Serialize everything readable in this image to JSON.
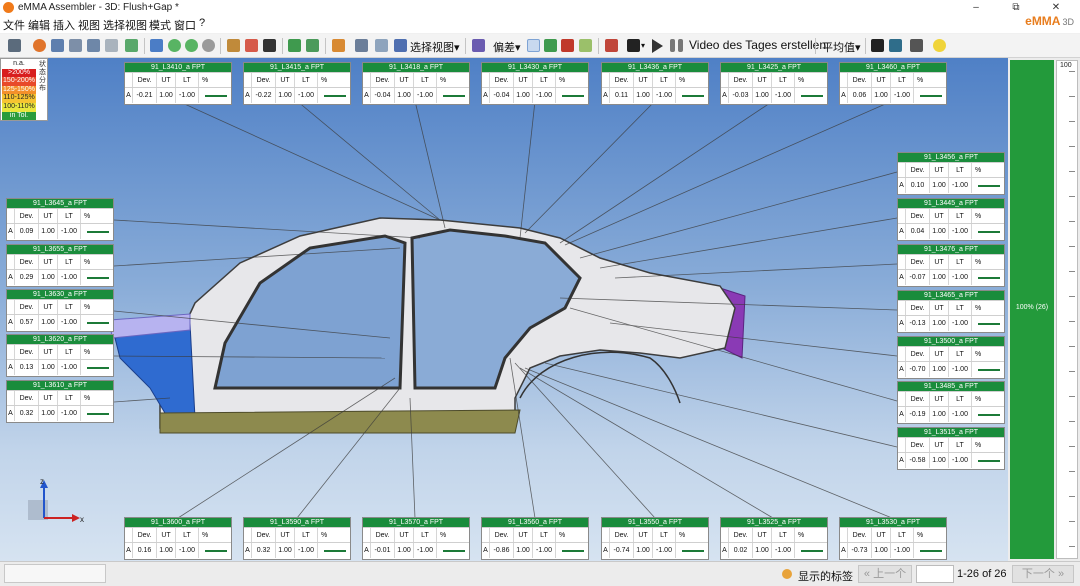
{
  "window": {
    "title": "eMMA Assembler - 3D: Flush+Gap *",
    "minimize": "–",
    "restore": "⧉",
    "close": "✕"
  },
  "brand": {
    "name": "eMMA",
    "suffix": "3D"
  },
  "menu": [
    "文件",
    "编辑",
    "插入",
    "视图",
    "选择视图",
    "模式",
    "窗口",
    "?"
  ],
  "toolbar": {
    "icons": [
      "new-icon",
      "open-icon",
      "save-icon",
      "save-as-icon",
      "print-icon",
      "copy-icon",
      "paste-icon",
      "refresh-icon",
      "back-icon",
      "forward-icon",
      "stop-icon",
      "import-icon",
      "export-icon",
      "pin-icon",
      "fit-icon",
      "link-icon",
      "home-icon",
      "camera-icon",
      "report-icon",
      "views-icon"
    ],
    "select_view": "选择视图",
    "deviation": "偏差",
    "video": "Video des Tages erstellen",
    "average": "平均值",
    "dropdown_arrow": "▾"
  },
  "legend": {
    "rows": [
      {
        "label": "n.a.",
        "color": "#ffffff"
      },
      {
        "label": ">200%",
        "color": "#d81e1e"
      },
      {
        "label": "150-200%",
        "color": "#e84a2a"
      },
      {
        "label": "125-150%",
        "color": "#f3902a"
      },
      {
        "label": "110-125%",
        "color": "#f6c431"
      },
      {
        "label": "100-110%",
        "color": "#e9e63c"
      },
      {
        "label": "in Tol.",
        "color": "#2a9c3c"
      }
    ],
    "vertical": "状态分布"
  },
  "card_headers": {
    "a": "A",
    "dev": "Dev.",
    "ut": "UT",
    "lt": "LT",
    "pct": "%"
  },
  "cards": [
    {
      "id": "91_L3410_a FPT",
      "dev": "-0.21",
      "ut": "1.00",
      "lt": "-1.00"
    },
    {
      "id": "91_L3415_a FPT",
      "dev": "-0.22",
      "ut": "1.00",
      "lt": "-1.00"
    },
    {
      "id": "91_L3418_a FPT",
      "dev": "-0.04",
      "ut": "1.00",
      "lt": "-1.00"
    },
    {
      "id": "91_L3430_a FPT",
      "dev": "-0.04",
      "ut": "1.00",
      "lt": "-1.00"
    },
    {
      "id": "91_L3436_a FPT",
      "dev": "0.11",
      "ut": "1.00",
      "lt": "-1.00"
    },
    {
      "id": "91_L3425_a FPT",
      "dev": "-0.03",
      "ut": "1.00",
      "lt": "-1.00"
    },
    {
      "id": "91_L3460_a FPT",
      "dev": "0.06",
      "ut": "1.00",
      "lt": "-1.00"
    },
    {
      "id": "91_L3456_a FPT",
      "dev": "0.10",
      "ut": "1.00",
      "lt": "-1.00"
    },
    {
      "id": "91_L3445_a FPT",
      "dev": "0.04",
      "ut": "1.00",
      "lt": "-1.00"
    },
    {
      "id": "91_L3476_a FPT",
      "dev": "-0.07",
      "ut": "1.00",
      "lt": "-1.00"
    },
    {
      "id": "91_L3465_a FPT",
      "dev": "-0.13",
      "ut": "1.00",
      "lt": "-1.00"
    },
    {
      "id": "91_L3500_a FPT",
      "dev": "-0.70",
      "ut": "1.00",
      "lt": "-1.00"
    },
    {
      "id": "91_L3485_a FPT",
      "dev": "-0.19",
      "ut": "1.00",
      "lt": "-1.00"
    },
    {
      "id": "91_L3515_a FPT",
      "dev": "-0.58",
      "ut": "1.00",
      "lt": "-1.00"
    },
    {
      "id": "91_L3645_a FPT",
      "dev": "0.09",
      "ut": "1.00",
      "lt": "-1.00"
    },
    {
      "id": "91_L3655_a FPT",
      "dev": "0.29",
      "ut": "1.00",
      "lt": "-1.00"
    },
    {
      "id": "91_L3630_a FPT",
      "dev": "0.57",
      "ut": "1.00",
      "lt": "-1.00"
    },
    {
      "id": "91_L3620_a FPT",
      "dev": "0.13",
      "ut": "1.00",
      "lt": "-1.00"
    },
    {
      "id": "91_L3610_a FPT",
      "dev": "0.32",
      "ut": "1.00",
      "lt": "-1.00"
    },
    {
      "id": "91_L3600_a FPT",
      "dev": "0.16",
      "ut": "1.00",
      "lt": "-1.00"
    },
    {
      "id": "91_L3590_a FPT",
      "dev": "0.32",
      "ut": "1.00",
      "lt": "-1.00"
    },
    {
      "id": "91_L3570_a FPT",
      "dev": "-0.01",
      "ut": "1.00",
      "lt": "-1.00"
    },
    {
      "id": "91_L3560_a FPT",
      "dev": "-0.86",
      "ut": "1.00",
      "lt": "-1.00"
    },
    {
      "id": "91_L3550_a FPT",
      "dev": "-0.74",
      "ut": "1.00",
      "lt": "-1.00"
    },
    {
      "id": "91_L3525_a FPT",
      "dev": "0.02",
      "ut": "1.00",
      "lt": "-1.00"
    },
    {
      "id": "91_L3530_a FPT",
      "dev": "-0.73",
      "ut": "1.00",
      "lt": "-1.00"
    }
  ],
  "axis": {
    "z": "z",
    "x": "x"
  },
  "gauge": {
    "scale_max": "100",
    "label": "100% (26)",
    "in_tolerance_fraction": 1.0
  },
  "status": {
    "show_labels": "显示的标签",
    "prev": "« 上一个",
    "counter": "1-26 of 26",
    "next": "下一个 »",
    "page_value": ""
  }
}
